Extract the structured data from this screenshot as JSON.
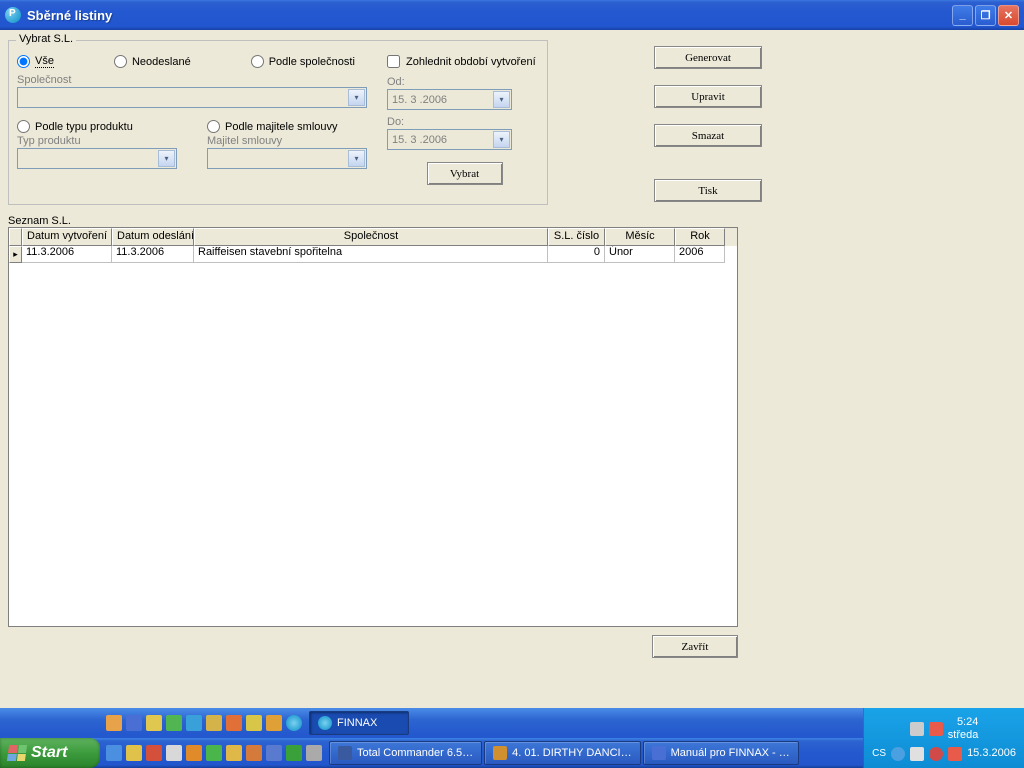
{
  "window": {
    "title": "Sběrné listiny"
  },
  "vybrat": {
    "legend": "Vybrat S.L.",
    "r_vse": "Vše",
    "r_neodeslane": "Neodeslané",
    "r_podle_spolecnosti": "Podle společnosti",
    "lbl_spolecnost": "Společnost",
    "r_podle_typu": "Podle typu produktu",
    "r_podle_majitele": "Podle majitele smlouvy",
    "lbl_typ": "Typ produktu",
    "lbl_majitel": "Majitel smlouvy",
    "chk_obdobi": "Zohlednit období vytvoření",
    "lbl_od": "Od:",
    "lbl_do": "Do:",
    "date_od": "15. 3 .2006",
    "date_do": "15. 3 .2006",
    "btn_vybrat": "Vybrat"
  },
  "buttons": {
    "generovat": "Generovat",
    "upravit": "Upravit",
    "smazat": "Smazat",
    "tisk": "Tisk",
    "zavrit": "Zavřít"
  },
  "seznam": {
    "label": "Seznam S.L.",
    "headers": {
      "datum_vytvoreni": "Datum vytvoření",
      "datum_odeslani": "Datum odeslání",
      "spolecnost": "Společnost",
      "sl_cislo": "S.L. číslo",
      "mesic": "Měsíc",
      "rok": "Rok"
    },
    "rows": [
      {
        "dv": "11.3.2006",
        "do": "11.3.2006",
        "sp": "Raiffeisen stavební spořitelna",
        "sl": "0",
        "me": "Únor",
        "ro": "2006"
      }
    ]
  },
  "taskbar": {
    "start": "Start",
    "tasks": [
      "Total Commander 6.5…",
      "4. 01. DIRTHY DANCI…",
      "Manuál pro FINNAX - …",
      "FINNAX"
    ],
    "lang": "CS",
    "time": "5:24",
    "day": "středa",
    "date": "15.3.2006"
  }
}
